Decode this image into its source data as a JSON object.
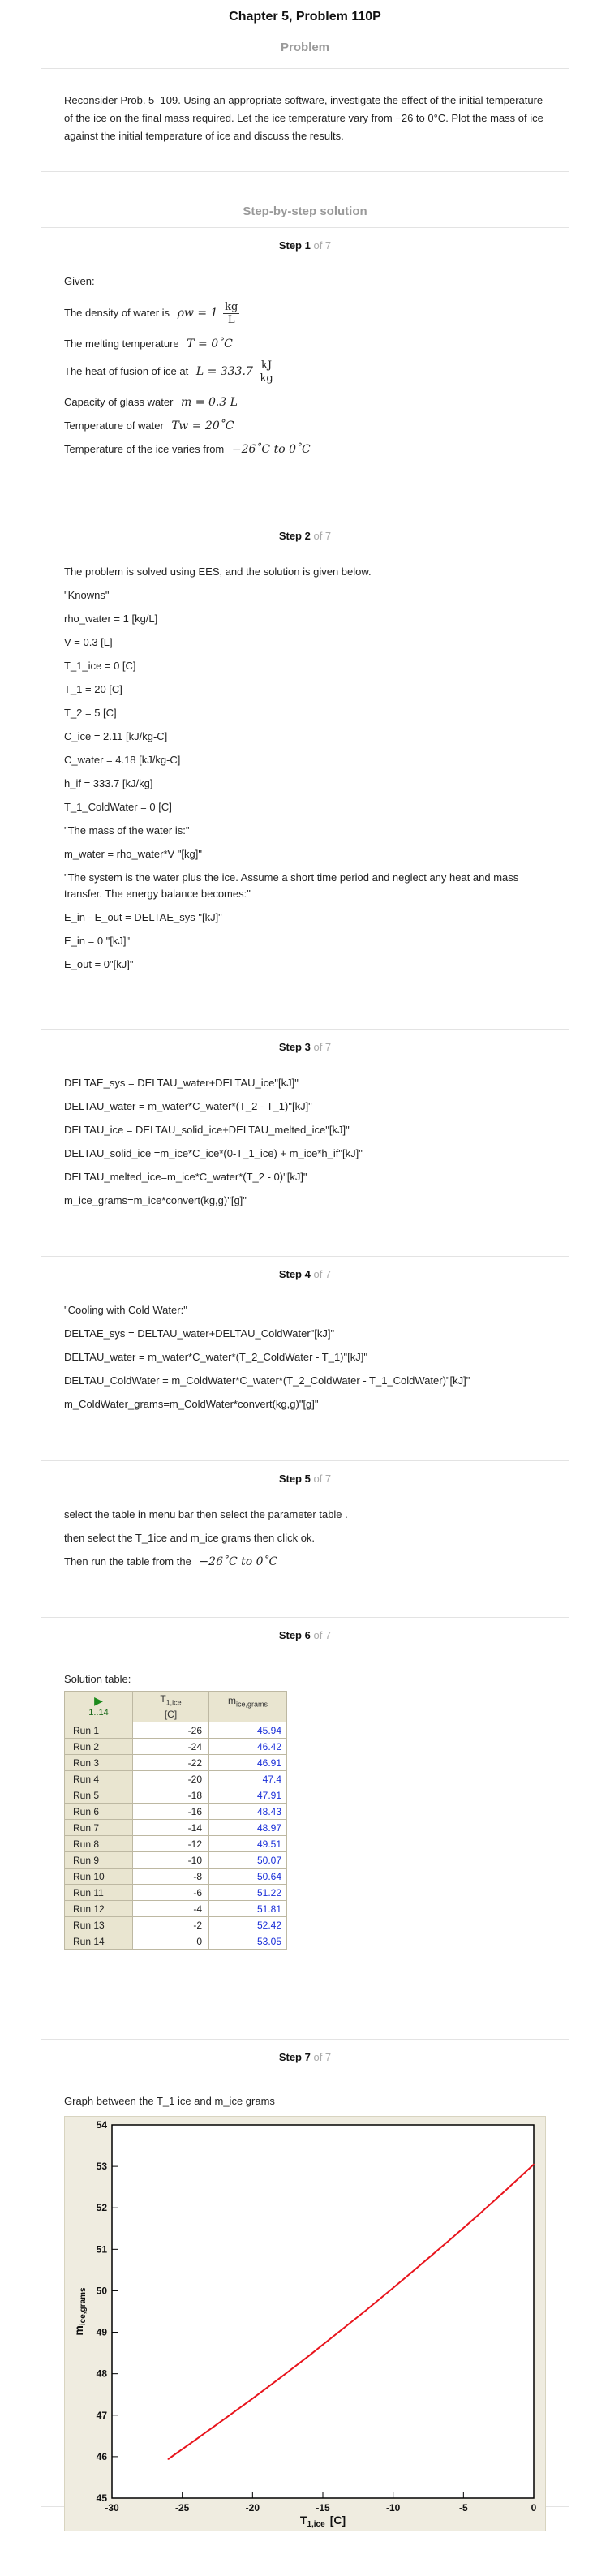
{
  "page": {
    "title": "Chapter 5, Problem 110P",
    "problem_heading": "Problem",
    "problem_text": "Reconsider Prob. 5–109. Using an appropriate software, investigate the effect of the initial temperature of the ice on the final mass required. Let the ice temperature vary from −26 to 0°C. Plot the mass of ice against the initial temperature of ice and discuss the results.",
    "solution_heading": "Step-by-step solution"
  },
  "steps": [
    {
      "label": "Step 1",
      "of": "of 7"
    },
    {
      "label": "Step 2",
      "of": "of 7"
    },
    {
      "label": "Step 3",
      "of": "of 7"
    },
    {
      "label": "Step 4",
      "of": "of 7"
    },
    {
      "label": "Step 5",
      "of": "of 7"
    },
    {
      "label": "Step 6",
      "of": "of 7"
    },
    {
      "label": "Step 7",
      "of": "of 7"
    }
  ],
  "step1": {
    "given": "Given:",
    "density_text": "The density of water is",
    "density_lhs": "ρw = 1",
    "density_num": "kg",
    "density_den": "L",
    "melting_text": "The melting temperature",
    "melting_math": "T = 0˚C",
    "fusion_text": "The heat of fusion of ice at",
    "fusion_lhs": "L = 333.7",
    "fusion_num": "kJ",
    "fusion_den": "kg",
    "capacity_text": "Capacity of glass water",
    "capacity_math": "m = 0.3 L",
    "water_temp_text": "Temperature of water",
    "water_temp_math": "Tw = 20˚C",
    "ice_temp_text": "Temperature of the ice varies from",
    "ice_temp_math": "−26˚C to 0˚C"
  },
  "step2": {
    "lines": [
      "The problem is solved using EES, and the solution is given below.",
      "\"Knowns\"",
      "rho_water = 1 [kg/L]",
      "V = 0.3 [L]",
      "T_1_ice = 0 [C]",
      "T_1 = 20 [C]",
      "T_2 = 5 [C]",
      "C_ice = 2.11 [kJ/kg-C]",
      "C_water = 4.18 [kJ/kg-C]",
      "h_if = 333.7 [kJ/kg]",
      "T_1_ColdWater = 0 [C]",
      "\"The mass of the water is:\"",
      "m_water = rho_water*V \"[kg]\"",
      "\"The system is the water plus the ice. Assume a short time period and neglect any heat and mass transfer. The energy balance becomes:\"",
      "E_in - E_out = DELTAE_sys \"[kJ]\"",
      "E_in = 0 \"[kJ]\"",
      "E_out = 0\"[kJ]\""
    ]
  },
  "step3": {
    "lines": [
      "DELTAE_sys = DELTAU_water+DELTAU_ice\"[kJ]\"",
      "DELTAU_water = m_water*C_water*(T_2 - T_1)\"[kJ]\"",
      "DELTAU_ice = DELTAU_solid_ice+DELTAU_melted_ice\"[kJ]\"",
      "DELTAU_solid_ice =m_ice*C_ice*(0-T_1_ice) + m_ice*h_if\"[kJ]\"",
      "DELTAU_melted_ice=m_ice*C_water*(T_2 - 0)\"[kJ]\"",
      "m_ice_grams=m_ice*convert(kg,g)\"[g]\""
    ]
  },
  "step4": {
    "lines": [
      "\"Cooling with Cold Water:\"",
      "DELTAE_sys = DELTAU_water+DELTAU_ColdWater\"[kJ]\"",
      "DELTAU_water = m_water*C_water*(T_2_ColdWater - T_1)\"[kJ]\"",
      "DELTAU_ColdWater = m_ColdWater*C_water*(T_2_ColdWater - T_1_ColdWater)\"[kJ]\"",
      "m_ColdWater_grams=m_ColdWater*convert(kg,g)\"[g]\""
    ]
  },
  "step5": {
    "line1": "select the table in menu bar then select the parameter table .",
    "line2": "then select the T_1ice and m_ice grams then click ok.",
    "line3": "Then run the table from the",
    "line3_math": "−26˚C to 0˚C"
  },
  "step6": {
    "caption": "Solution table:",
    "corner": "1..14",
    "col1_main": "T",
    "col1_sub": "1,ice",
    "col1_unit": "[C]",
    "col2_main": "m",
    "col2_sub": "ice,grams",
    "rows": [
      {
        "run": "Run 1",
        "t": "-26",
        "m": "45.94"
      },
      {
        "run": "Run 2",
        "t": "-24",
        "m": "46.42"
      },
      {
        "run": "Run 3",
        "t": "-22",
        "m": "46.91"
      },
      {
        "run": "Run 4",
        "t": "-20",
        "m": "47.4"
      },
      {
        "run": "Run 5",
        "t": "-18",
        "m": "47.91"
      },
      {
        "run": "Run 6",
        "t": "-16",
        "m": "48.43"
      },
      {
        "run": "Run 7",
        "t": "-14",
        "m": "48.97"
      },
      {
        "run": "Run 8",
        "t": "-12",
        "m": "49.51"
      },
      {
        "run": "Run 9",
        "t": "-10",
        "m": "50.07"
      },
      {
        "run": "Run 10",
        "t": "-8",
        "m": "50.64"
      },
      {
        "run": "Run 11",
        "t": "-6",
        "m": "51.22"
      },
      {
        "run": "Run 12",
        "t": "-4",
        "m": "51.81"
      },
      {
        "run": "Run 13",
        "t": "-2",
        "m": "52.42"
      },
      {
        "run": "Run 14",
        "t": "0",
        "m": "53.05"
      }
    ]
  },
  "step7": {
    "caption": "Graph between the T_1 ice and m_ice grams"
  },
  "chart_data": {
    "type": "line",
    "title": "",
    "xlabel_main": "T",
    "xlabel_sub": "1,ice",
    "xlabel_unit": "[C]",
    "ylabel_main": "m",
    "ylabel_sub": "ice,grams",
    "xlim": [
      -30,
      0
    ],
    "ylim": [
      45,
      54
    ],
    "xticks": [
      "-30",
      "-25",
      "-20",
      "-15",
      "-10",
      "-5",
      "0"
    ],
    "xtick_values": [
      -30,
      -25,
      -20,
      -15,
      -10,
      -5,
      0
    ],
    "yticks": [
      "45",
      "46",
      "47",
      "48",
      "49",
      "50",
      "51",
      "52",
      "53",
      "54"
    ],
    "ytick_values": [
      45,
      46,
      47,
      48,
      49,
      50,
      51,
      52,
      53,
      54
    ],
    "grid": false,
    "line_color": "#e8141c",
    "x": [
      -26,
      -24,
      -22,
      -20,
      -18,
      -16,
      -14,
      -12,
      -10,
      -8,
      -6,
      -4,
      -2,
      0
    ],
    "y": [
      45.94,
      46.42,
      46.91,
      47.4,
      47.91,
      48.43,
      48.97,
      49.51,
      50.07,
      50.64,
      51.22,
      51.81,
      52.42,
      53.05
    ]
  }
}
